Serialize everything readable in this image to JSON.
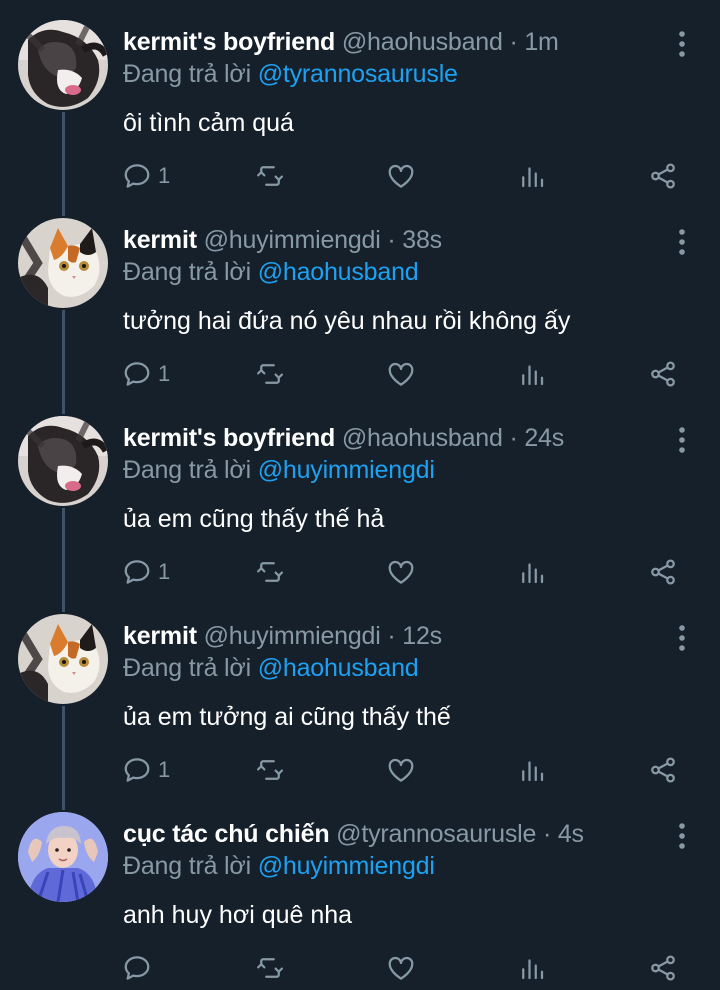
{
  "colors": {
    "background": "#15202b",
    "primary_text": "#ffffff",
    "secondary_text": "#8899a6",
    "mention": "#1da1f2",
    "thread_line": "#3d5466"
  },
  "icons": {
    "reply": "reply-icon",
    "retweet": "retweet-icon",
    "like": "heart-icon",
    "analytics": "analytics-icon",
    "share": "share-icon",
    "more": "more-icon"
  },
  "tweets": [
    {
      "name": "kermit's boyfriend",
      "handle": "@haohusband",
      "separator": "·",
      "time": "1m",
      "reply_prefix": "Đang trả lời",
      "reply_to": "@tyrannosaurusle",
      "text": "ôi tình cảm quá",
      "reply_count": "1",
      "avatar": "black-white-cat"
    },
    {
      "name": "kermit",
      "handle": "@huyimmiengdi",
      "separator": "·",
      "time": "38s",
      "reply_prefix": "Đang trả lời",
      "reply_to": "@haohusband",
      "text": "tưởng hai đứa nó yêu nhau rồi không ấy",
      "reply_count": "1",
      "avatar": "calico-cat"
    },
    {
      "name": "kermit's boyfriend",
      "handle": "@haohusband",
      "separator": "·",
      "time": "24s",
      "reply_prefix": "Đang trả lời",
      "reply_to": "@huyimmiengdi",
      "text": "ủa em cũng thấy thế hả",
      "reply_count": "1",
      "avatar": "black-white-cat"
    },
    {
      "name": "kermit",
      "handle": "@huyimmiengdi",
      "separator": "·",
      "time": "12s",
      "reply_prefix": "Đang trả lời",
      "reply_to": "@haohusband",
      "text": "ủa em tưởng ai cũng thấy thế",
      "reply_count": "1",
      "avatar": "calico-cat"
    },
    {
      "name": "cục tác chú chiến",
      "handle": "@tyrannosaurusle",
      "separator": "·",
      "time": "4s",
      "reply_prefix": "Đang trả lời",
      "reply_to": "@huyimmiengdi",
      "text": "anh huy hơi quê nha",
      "reply_count": "",
      "avatar": "person-photo"
    }
  ]
}
